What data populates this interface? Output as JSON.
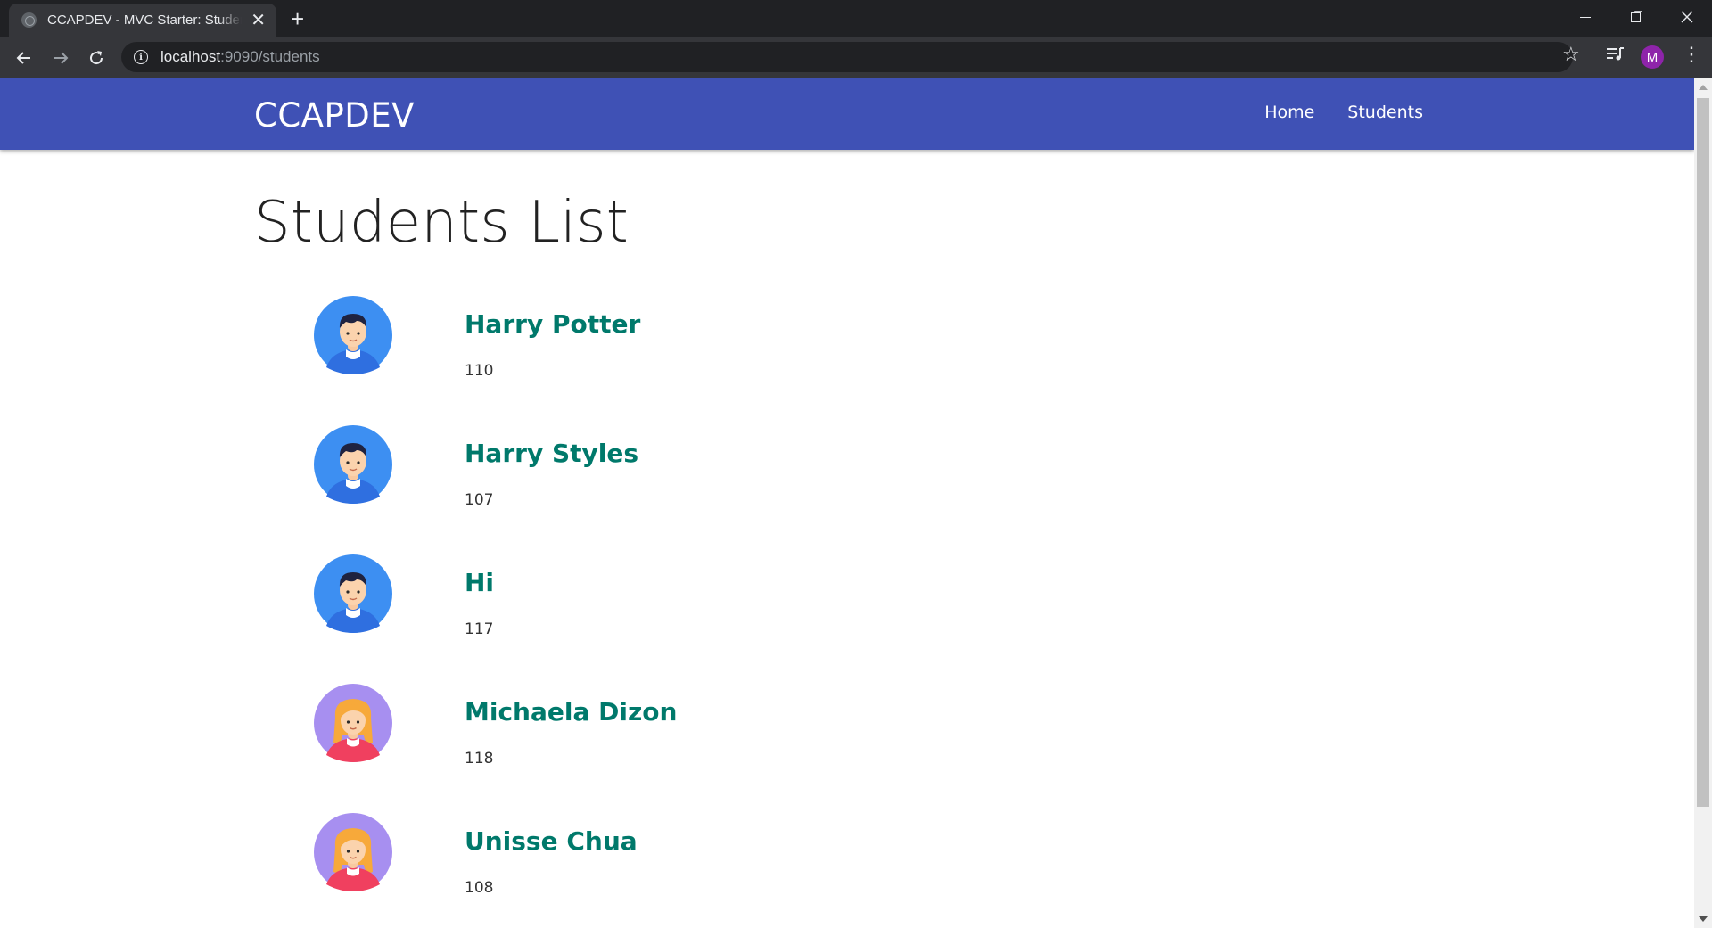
{
  "browser": {
    "tab_title": "CCAPDEV - MVC Starter: Students",
    "tab_close": "✕",
    "new_tab": "+",
    "url_host": "localhost",
    "url_path": ":9090/students",
    "profile_initial": "M"
  },
  "site": {
    "brand": "CCAPDEV",
    "nav": [
      {
        "label": "Home"
      },
      {
        "label": "Students"
      }
    ]
  },
  "page": {
    "title": "Students List"
  },
  "students": [
    {
      "name": "Harry Potter",
      "id": "110",
      "avatar": "male-avatar-icon"
    },
    {
      "name": "Harry Styles",
      "id": "107",
      "avatar": "male-avatar-icon"
    },
    {
      "name": "Hi",
      "id": "117",
      "avatar": "male-avatar-icon"
    },
    {
      "name": "Michaela Dizon",
      "id": "118",
      "avatar": "female-avatar-icon"
    },
    {
      "name": "Unisse Chua",
      "id": "108",
      "avatar": "female-avatar-icon"
    }
  ],
  "colors": {
    "navbar": "#3f51b5",
    "student_name": "#00796b",
    "male_avatar_bg": "#3d8ff2",
    "female_avatar_bg": "#a78ff0"
  }
}
